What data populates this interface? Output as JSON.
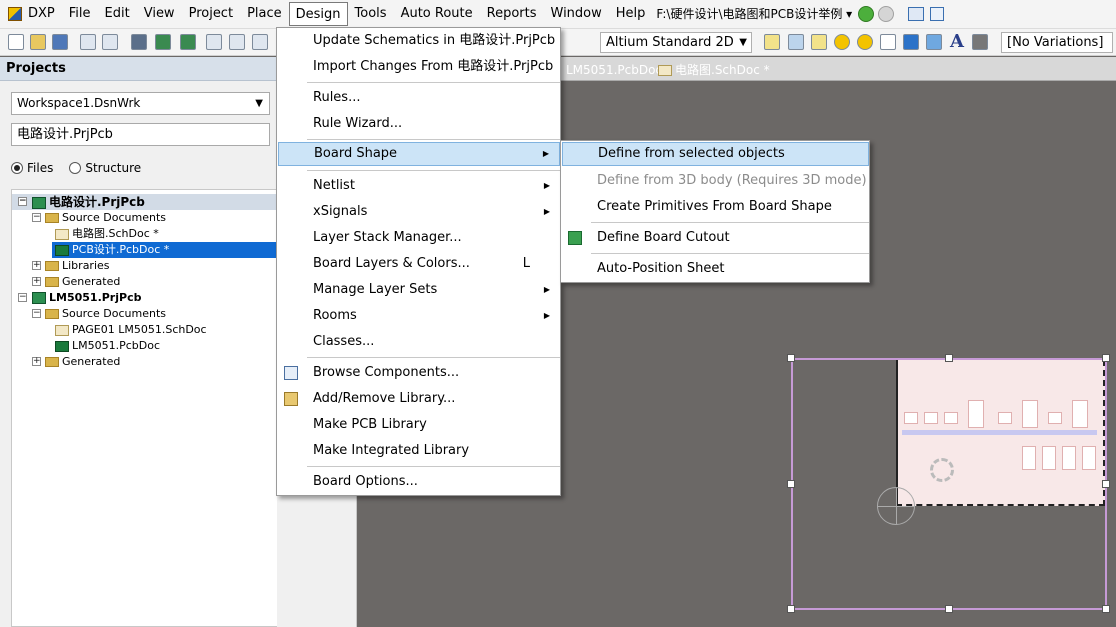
{
  "menubar": {
    "items": [
      "DXP",
      "File",
      "Edit",
      "View",
      "Project",
      "Place",
      "Design",
      "Tools",
      "Auto Route",
      "Reports",
      "Window",
      "Help"
    ],
    "path": "F:\\硬件设计\\电路图和PCB设计举例 ▾"
  },
  "toolbar": {
    "view_mode": "Altium Standard 2D",
    "variations": "[No Variations]"
  },
  "projects_panel": {
    "title": "Projects",
    "workspace": "Workspace1.DsnWrk",
    "current_project": "电路设计.PrjPcb",
    "view_files": "Files",
    "view_structure": "Structure"
  },
  "tree": [
    {
      "label": "电路设计.PrjPcb",
      "level": 0,
      "kind": "project",
      "expander": "−"
    },
    {
      "label": "Source Documents",
      "level": 1,
      "kind": "folder",
      "expander": "−"
    },
    {
      "label": "电路图.SchDoc *",
      "level": 2,
      "kind": "sch",
      "expander": ""
    },
    {
      "label": "PCB设计.PcbDoc *",
      "level": 2,
      "kind": "pcb",
      "expander": ""
    },
    {
      "label": "Libraries",
      "level": 1,
      "kind": "folder",
      "expander": "+"
    },
    {
      "label": "Generated",
      "level": 1,
      "kind": "folder",
      "expander": "+"
    },
    {
      "label": "LM5051.PrjPcb",
      "level": 0,
      "kind": "project",
      "expander": "−"
    },
    {
      "label": "Source Documents",
      "level": 1,
      "kind": "folder",
      "expander": "−"
    },
    {
      "label": "PAGE01 LM5051.SchDoc",
      "level": 2,
      "kind": "sch",
      "expander": ""
    },
    {
      "label": "LM5051.PcbDoc",
      "level": 2,
      "kind": "pcb",
      "expander": ""
    },
    {
      "label": "Generated",
      "level": 1,
      "kind": "folder",
      "expander": "+"
    }
  ],
  "doc_tabs": [
    "LM5051.PcbDoc",
    "电路图.SchDoc *"
  ],
  "design_menu": {
    "items": [
      {
        "label": "Update Schematics in 电路设计.PrjPcb",
        "shortcut": "",
        "submenu": false
      },
      {
        "label": "Import Changes From 电路设计.PrjPcb",
        "shortcut": "",
        "submenu": false
      },
      {
        "label": "Rules...",
        "shortcut": "",
        "submenu": false
      },
      {
        "label": "Rule Wizard...",
        "shortcut": "",
        "submenu": false
      },
      {
        "label": "Board Shape",
        "shortcut": "",
        "submenu": true
      },
      {
        "label": "Netlist",
        "shortcut": "",
        "submenu": true
      },
      {
        "label": "xSignals",
        "shortcut": "",
        "submenu": true
      },
      {
        "label": "Layer Stack Manager...",
        "shortcut": "",
        "submenu": false
      },
      {
        "label": "Board Layers & Colors...",
        "shortcut": "L",
        "submenu": false
      },
      {
        "label": "Manage Layer Sets",
        "shortcut": "",
        "submenu": true
      },
      {
        "label": "Rooms",
        "shortcut": "",
        "submenu": true
      },
      {
        "label": "Classes...",
        "shortcut": "",
        "submenu": false
      },
      {
        "label": "Browse Components...",
        "shortcut": "",
        "submenu": false
      },
      {
        "label": "Add/Remove Library...",
        "shortcut": "",
        "submenu": false
      },
      {
        "label": "Make PCB Library",
        "shortcut": "",
        "submenu": false
      },
      {
        "label": "Make Integrated Library",
        "shortcut": "",
        "submenu": false
      },
      {
        "label": "Board Options...",
        "shortcut": "",
        "submenu": false
      }
    ]
  },
  "board_shape_submenu": {
    "items": [
      {
        "label": "Define from selected objects",
        "disabled": false
      },
      {
        "label": "Define from 3D body (Requires 3D mode)",
        "disabled": true
      },
      {
        "label": "Create Primitives From Board Shape",
        "disabled": false
      },
      {
        "label": "Define Board Cutout",
        "disabled": false
      },
      {
        "label": "Auto-Position Sheet",
        "disabled": false
      }
    ]
  },
  "colors": {
    "menu_highlight": "#cce4f7",
    "canvas_background": "#6b6866",
    "board_outline": "#c69ad6",
    "tree_selection": "#0f6ad3"
  }
}
